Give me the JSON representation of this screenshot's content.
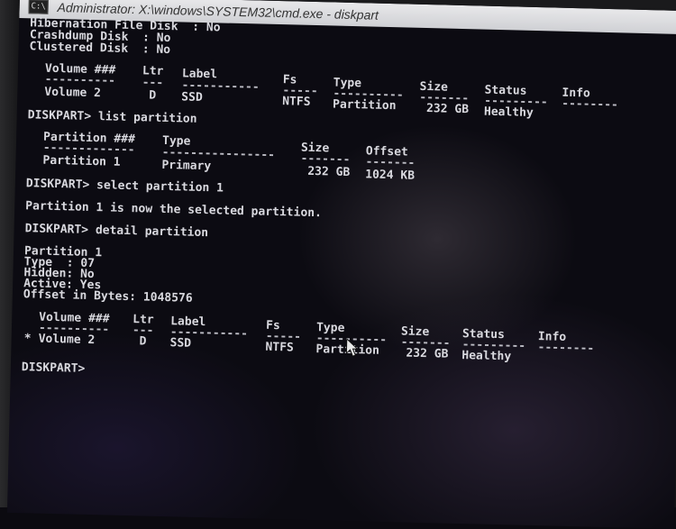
{
  "window": {
    "title": "Administrator: X:\\windows\\SYSTEM32\\cmd.exe - diskpart",
    "icon_text": "C:\\"
  },
  "console": {
    "top_lines": [
      "Hibernation File Disk  : No",
      "Crashdump Disk  : No",
      "Clustered Disk  : No"
    ],
    "volume_table_1": {
      "headers": [
        "Volume ###",
        "Ltr",
        "Label",
        "Fs",
        "Type",
        "Size",
        "Status",
        "Info"
      ],
      "dashes": [
        "----------",
        "---",
        "-----------",
        "-----",
        "----------",
        "-------",
        "---------",
        "--------"
      ],
      "row": [
        "Volume 2",
        "D",
        "SSD",
        "NTFS",
        "Partition",
        "232 GB",
        "Healthy",
        ""
      ]
    },
    "cmd_list_partition": "DISKPART> list partition",
    "partition_table": {
      "headers": [
        "Partition ###",
        "Type",
        "Size",
        "Offset"
      ],
      "dashes": [
        "-------------",
        "----------------",
        "-------",
        "-------"
      ],
      "row": [
        "Partition 1",
        "Primary",
        "232 GB",
        "1024 KB"
      ]
    },
    "cmd_select": "DISKPART> select partition 1",
    "select_result": "Partition 1 is now the selected partition.",
    "cmd_detail": "DISKPART> detail partition",
    "detail_lines": [
      "Partition 1",
      "Type  : 07",
      "Hidden: No",
      "Active: Yes",
      "Offset in Bytes: 1048576"
    ],
    "volume_table_2": {
      "headers": [
        "Volume ###",
        "Ltr",
        "Label",
        "Fs",
        "Type",
        "Size",
        "Status",
        "Info"
      ],
      "dashes": [
        "----------",
        "---",
        "-----------",
        "-----",
        "----------",
        "-------",
        "---------",
        "--------"
      ],
      "row_marker": "*",
      "row": [
        "Volume 2",
        "D",
        "SSD",
        "NTFS",
        "Partition",
        "232 GB",
        "Healthy",
        ""
      ]
    },
    "prompt": "DISKPART>"
  },
  "colors": {
    "text": "#d9d9df",
    "background": "#0c0b12",
    "titlebar": "#d6d7db"
  }
}
